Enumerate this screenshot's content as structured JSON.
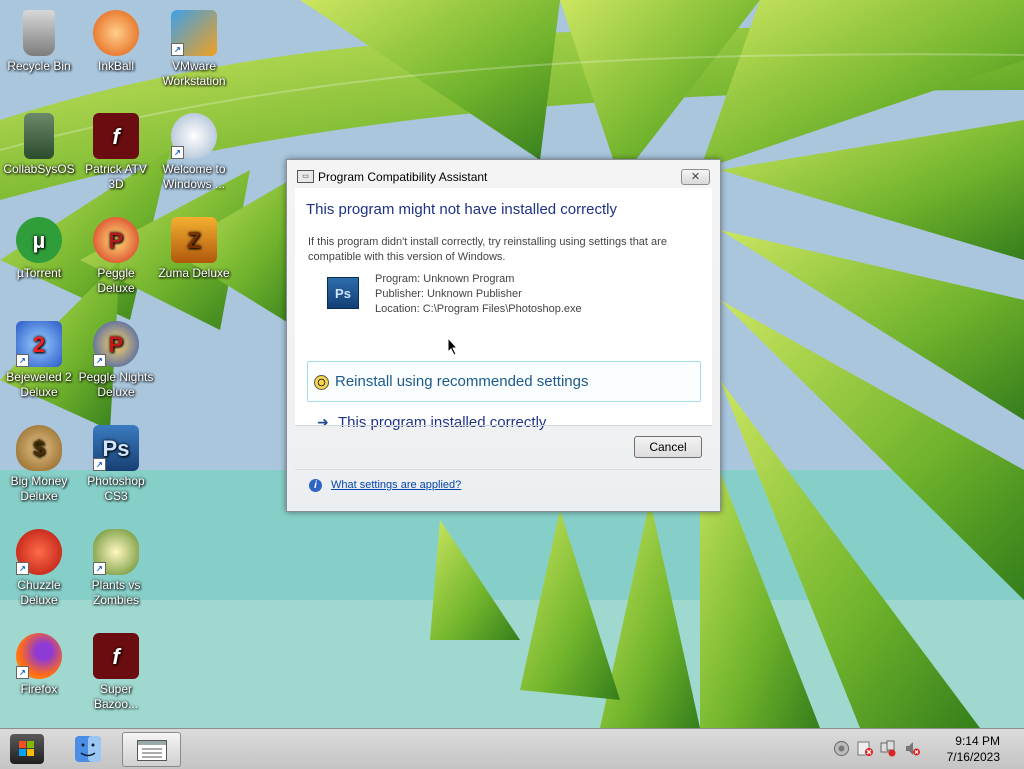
{
  "desktop": {
    "icons": [
      {
        "label": "Recycle Bin",
        "icon": "recycle-bin-icon"
      },
      {
        "label": "InkBall",
        "icon": "inkball-icon"
      },
      {
        "label": "VMware Workstation",
        "icon": "vmware-icon"
      },
      {
        "label": "CollabSysOS",
        "icon": "collabsysos-icon"
      },
      {
        "label": "Patrick ATV 3D",
        "icon": "flash-icon"
      },
      {
        "label": "Welcome to Windows ...",
        "icon": "windows-welcome-icon"
      },
      {
        "label": "µTorrent",
        "icon": "utorrent-icon"
      },
      {
        "label": "Peggle Deluxe",
        "icon": "peggle-icon"
      },
      {
        "label": "Zuma Deluxe",
        "icon": "zuma-icon"
      },
      {
        "label": "Bejeweled 2 Deluxe",
        "icon": "bejeweled-icon"
      },
      {
        "label": "Peggle Nights Deluxe",
        "icon": "peggle-nights-icon"
      },
      {
        "label": "Big Money Deluxe",
        "icon": "money-bag-icon"
      },
      {
        "label": "Photoshop CS3",
        "icon": "photoshop-icon"
      },
      {
        "label": "Chuzzle Deluxe",
        "icon": "chuzzle-icon"
      },
      {
        "label": "Plants vs Zombies",
        "icon": "plants-vs-zombies-icon"
      },
      {
        "label": "Firefox",
        "icon": "firefox-icon"
      },
      {
        "label": "Super Bazoo...",
        "icon": "flash-icon"
      }
    ]
  },
  "dialog": {
    "title": "Program Compatibility Assistant",
    "close_glyph": "✕",
    "heading": "This program might not have installed correctly",
    "description": "If this program didn't install correctly, try reinstalling using settings that are compatible with this version of Windows.",
    "program_badge": "Ps",
    "program": "Program: Unknown Program",
    "publisher": "Publisher: Unknown Publisher",
    "location": "Location: C:\\Program Files\\Photoshop.exe",
    "option_reinstall": "Reinstall using recommended settings",
    "option_correct": "This program installed correctly",
    "cancel_label": "Cancel",
    "help_link": "What settings are applied?"
  },
  "taskbar": {
    "time": "9:14 PM",
    "date": "7/16/2023"
  },
  "colors": {
    "heading": "#1e3287",
    "link": "#0645ad",
    "option_border": "#a7dcec"
  }
}
